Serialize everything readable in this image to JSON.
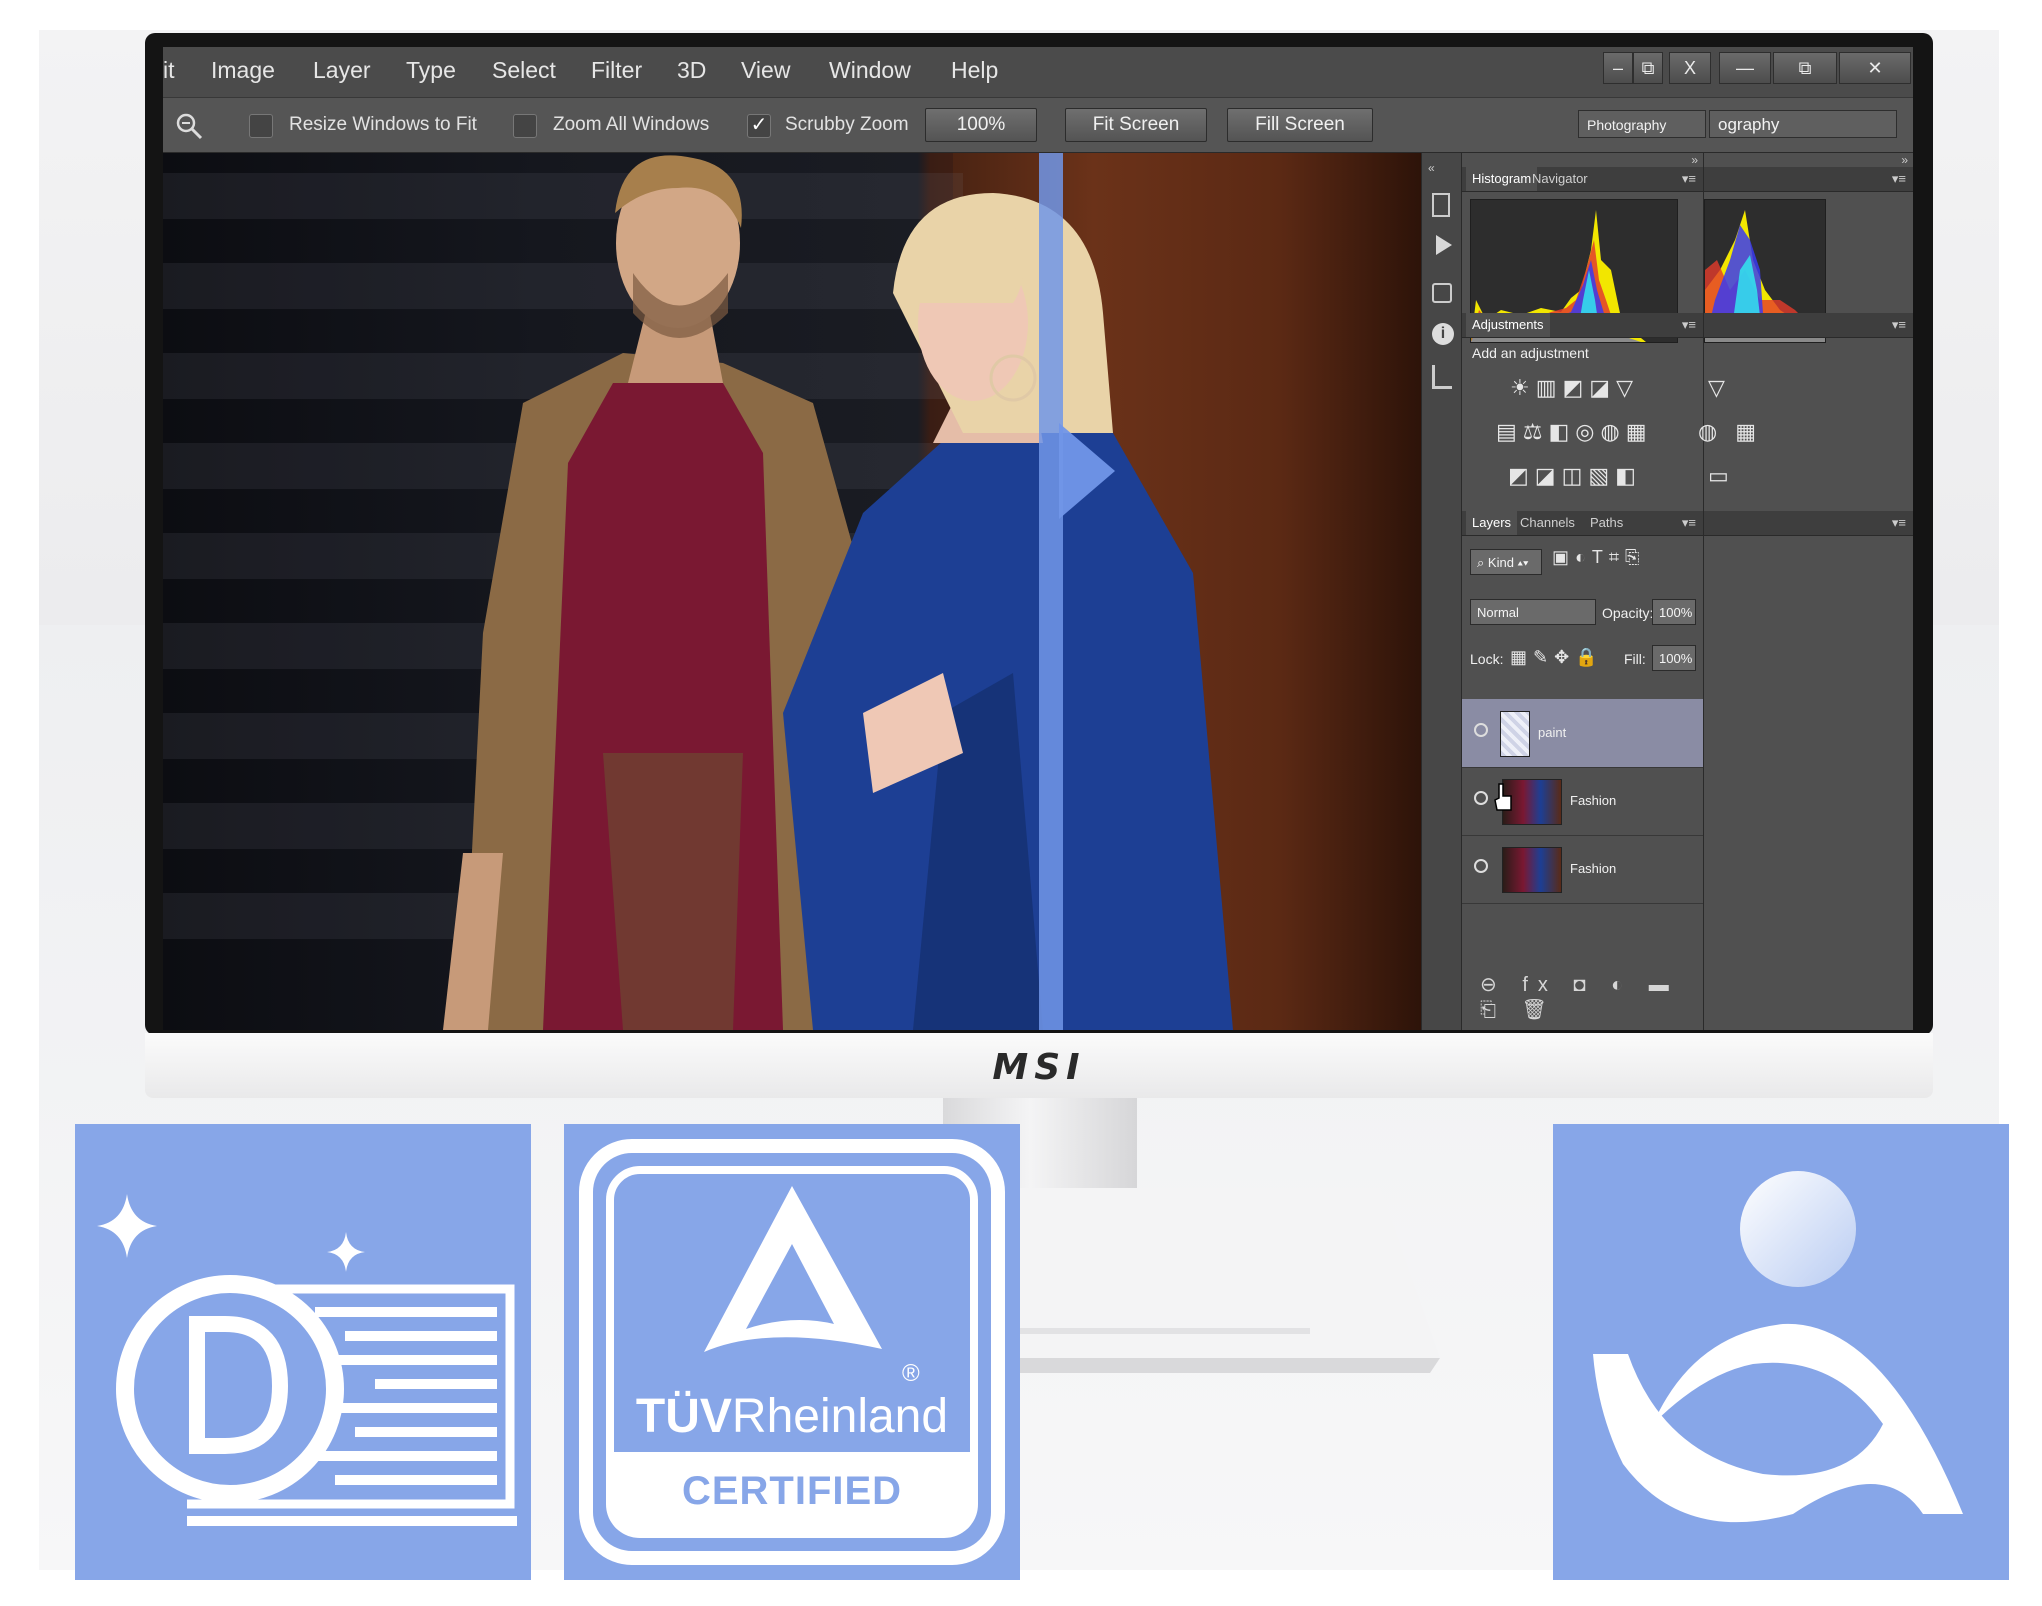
{
  "menu": [
    "it",
    "Image",
    "Layer",
    "Type",
    "Select",
    "Filter",
    "3D",
    "View",
    "Window",
    "Help"
  ],
  "window_controls": [
    "–",
    "⧉",
    "X",
    "—",
    "⧉",
    "✕"
  ],
  "options_bar": {
    "resize_windows": "Resize Windows to Fit",
    "zoom_all": "Zoom All Windows",
    "scrubby_zoom": "Scrubby Zoom",
    "zoom_value": "100%",
    "fit_screen": "Fit Screen",
    "fill_screen": "Fill Screen",
    "workspace_1": "Photography",
    "workspace_2": "ography"
  },
  "panels": {
    "histogram_tab": "Histogram",
    "navigator_tab": "Navigator",
    "adjustments_tab": "Adjustments",
    "add_adjustment": "Add an adjustment",
    "layers_tab": "Layers",
    "channels_tab": "Channels",
    "paths_tab": "Paths",
    "kind_label": "Kind",
    "blend_mode": "Normal",
    "opacity_label": "Opacity:",
    "opacity_value": "100%",
    "lock_label": "Lock:",
    "fill_label": "Fill:",
    "fill_value": "100%"
  },
  "layers": [
    {
      "name": "paint",
      "selected": true
    },
    {
      "name": "Fashion",
      "selected": false
    },
    {
      "name": "Fashion",
      "selected": false
    }
  ],
  "monitor": {
    "brand": "MSI"
  },
  "badges": {
    "tuv_brand_left": "TÜV",
    "tuv_brand_right": "Rheinland",
    "tuv_certified": "CERTIFIED",
    "tuv_registered": "®"
  },
  "icons": {
    "zoom": "zoom-icon",
    "eye": "eye-icon",
    "anti_flicker": "anti-flicker-icon",
    "eye_care": "eye-care-icon"
  },
  "colors": {
    "accent_blue": "#87a6e8",
    "split_bar": "#7196e8",
    "selected_layer": "#8a8ca4"
  }
}
